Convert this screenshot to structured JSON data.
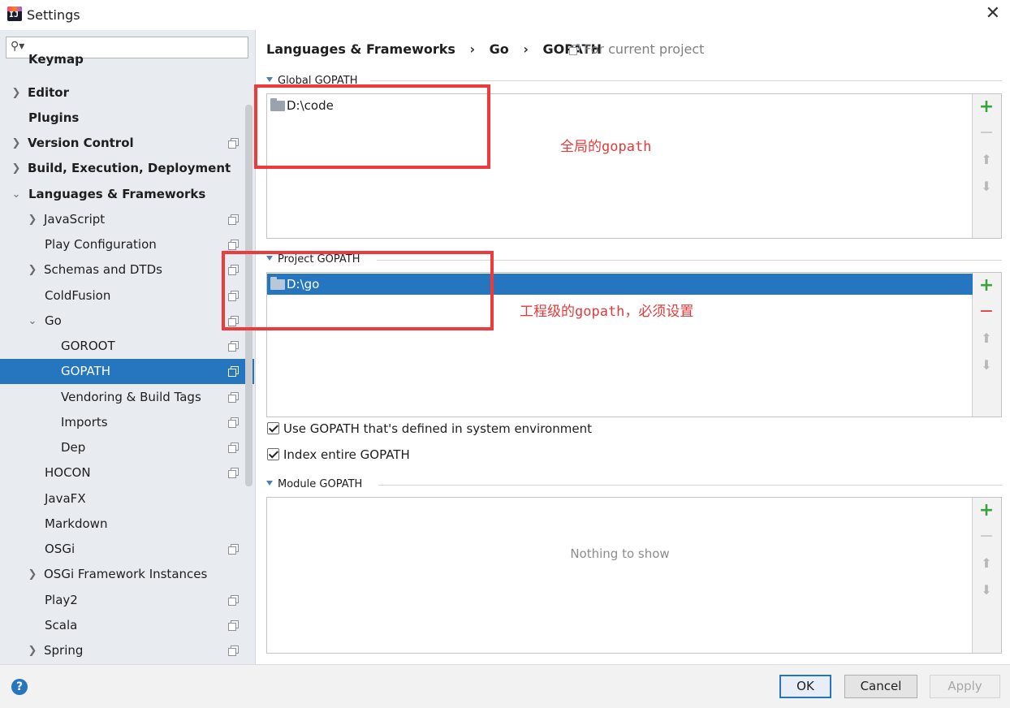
{
  "window": {
    "title": "Settings"
  },
  "search": {
    "placeholder": ""
  },
  "sidebar": {
    "items": [
      {
        "label": "Keymap"
      },
      {
        "label": "Editor"
      },
      {
        "label": "Plugins"
      },
      {
        "label": "Version Control"
      },
      {
        "label": "Build, Execution, Deployment"
      },
      {
        "label": "Languages & Frameworks"
      },
      {
        "label": "JavaScript"
      },
      {
        "label": "Play Configuration"
      },
      {
        "label": "Schemas and DTDs"
      },
      {
        "label": "ColdFusion"
      },
      {
        "label": "Go"
      },
      {
        "label": "GOROOT"
      },
      {
        "label": "GOPATH"
      },
      {
        "label": "Vendoring & Build Tags"
      },
      {
        "label": "Imports"
      },
      {
        "label": "Dep"
      },
      {
        "label": "HOCON"
      },
      {
        "label": "JavaFX"
      },
      {
        "label": "Markdown"
      },
      {
        "label": "OSGi"
      },
      {
        "label": "OSGi Framework Instances"
      },
      {
        "label": "Play2"
      },
      {
        "label": "Scala"
      },
      {
        "label": "Spring"
      }
    ]
  },
  "breadcrumb": {
    "items": [
      "Languages & Frameworks",
      "Go",
      "GOPATH"
    ],
    "separator": "›",
    "scope": "For current project"
  },
  "global_gopath": {
    "title": "Global GOPATH",
    "entries": [
      "D:\\code"
    ]
  },
  "project_gopath": {
    "title": "Project GOPATH",
    "entries": [
      "D:\\go"
    ]
  },
  "options": {
    "use_system_env": {
      "label": "Use GOPATH that's defined in system environment",
      "checked": true
    },
    "index_entire": {
      "label": "Index entire GOPATH",
      "checked": true
    }
  },
  "module_gopath": {
    "title": "Module GOPATH",
    "empty_text": "Nothing to show"
  },
  "annotations": {
    "global_note": "全局的gopath",
    "project_note": "工程级的gopath，必须设置",
    "color": "#ee3a3a"
  },
  "toolbar": {
    "add": "+",
    "remove": "−",
    "up": "⬆",
    "down": "⬇"
  },
  "footer": {
    "help": "?",
    "ok": "OK",
    "cancel": "Cancel",
    "apply": "Apply"
  },
  "colors": {
    "accent": "#2675bf",
    "sidebar_bg": "#e8ecf0",
    "add": "#3aa43a",
    "remove_active": "#d94141"
  }
}
